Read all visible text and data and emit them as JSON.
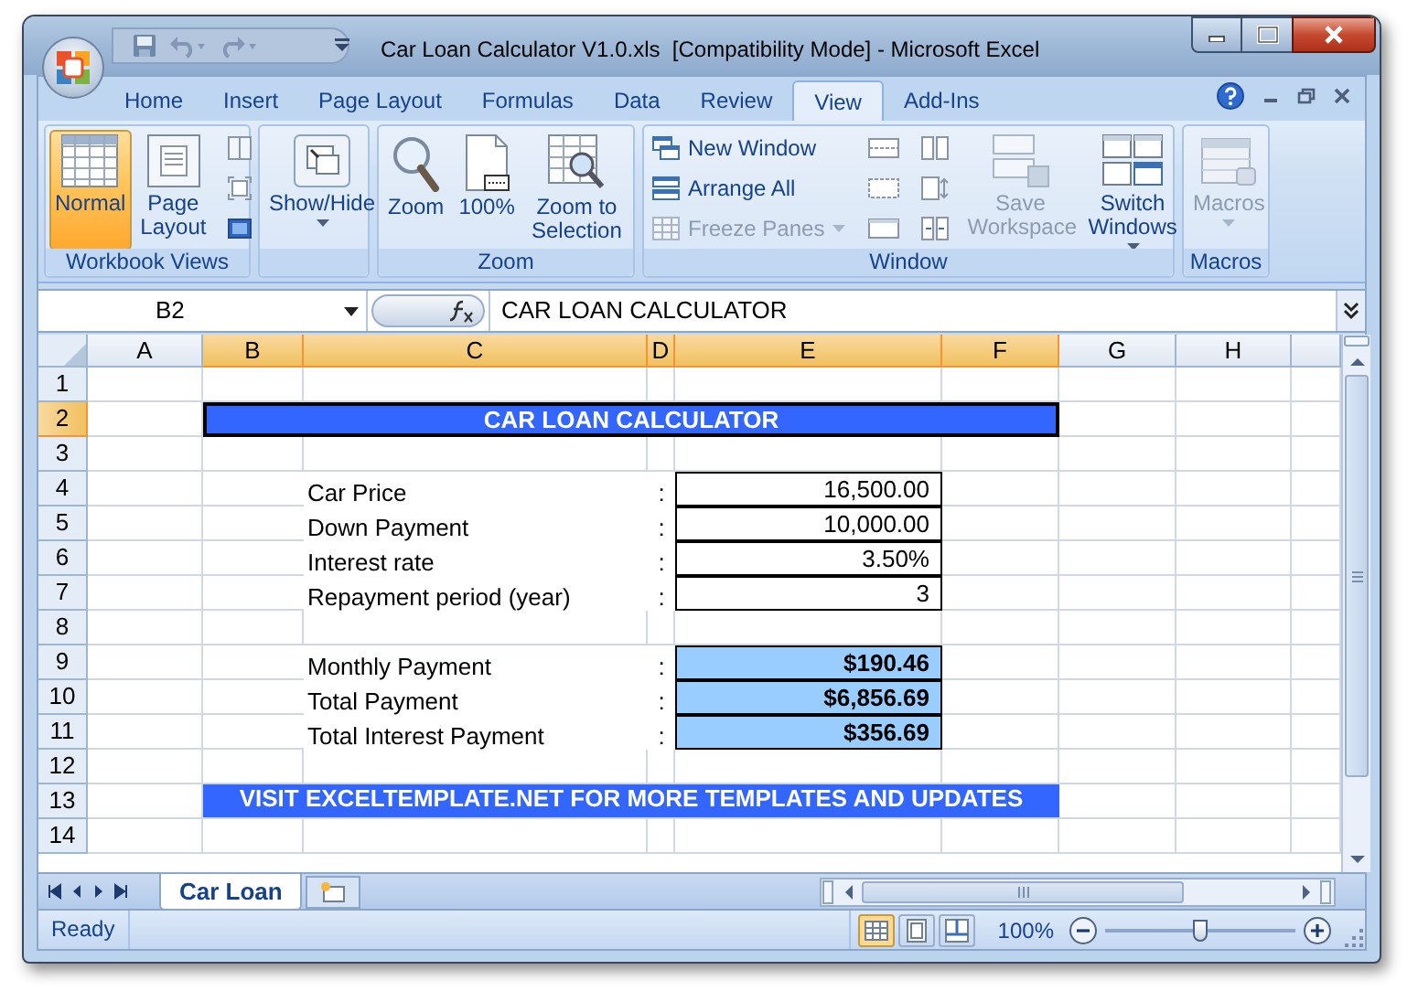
{
  "window": {
    "title": "Car Loan Calculator V1.0.xls  [Compatibility Mode] - Microsoft Excel"
  },
  "tabs": [
    {
      "label": "Home",
      "selected": false
    },
    {
      "label": "Insert",
      "selected": false
    },
    {
      "label": "Page Layout",
      "selected": false
    },
    {
      "label": "Formulas",
      "selected": false
    },
    {
      "label": "Data",
      "selected": false
    },
    {
      "label": "Review",
      "selected": false
    },
    {
      "label": "View",
      "selected": true
    },
    {
      "label": "Add-Ins",
      "selected": false
    }
  ],
  "ribbon": {
    "groups": [
      {
        "label": "Workbook Views",
        "items": [
          {
            "kind": "large",
            "label": "Normal",
            "selected": true,
            "disabled": false,
            "dropdown": false
          },
          {
            "kind": "large",
            "label": "Page Layout",
            "selected": false,
            "disabled": false,
            "dropdown": false
          },
          {
            "kind": "icon",
            "selected": false,
            "disabled": false,
            "dropdown": false
          },
          {
            "kind": "icon",
            "selected": false,
            "disabled": false,
            "dropdown": false
          },
          {
            "kind": "icon",
            "selected": false,
            "disabled": false,
            "dropdown": false
          }
        ]
      },
      {
        "items": [
          {
            "kind": "large",
            "label": "Show/Hide",
            "disabled": false,
            "dropdown": true
          }
        ]
      },
      {
        "label": "Zoom",
        "items": [
          {
            "kind": "large",
            "label": "Zoom",
            "disabled": false,
            "dropdown": false
          },
          {
            "kind": "large",
            "label": "100%",
            "disabled": false,
            "dropdown": false
          },
          {
            "kind": "large",
            "label": "Zoom to Selection",
            "disabled": false,
            "dropdown": false
          }
        ]
      },
      {
        "label": "Window",
        "items": [
          {
            "kind": "small",
            "label": "New Window",
            "disabled": false,
            "dropdown": false
          },
          {
            "kind": "small",
            "label": "Arrange All",
            "disabled": false,
            "dropdown": false
          },
          {
            "kind": "small",
            "label": "Freeze Panes",
            "disabled": true,
            "dropdown": true
          },
          {
            "kind": "icon",
            "disabled": false,
            "dropdown": false
          },
          {
            "kind": "icon",
            "disabled": false,
            "dropdown": false
          },
          {
            "kind": "icon",
            "disabled": false,
            "dropdown": false
          },
          {
            "kind": "icon",
            "disabled": false,
            "dropdown": false
          },
          {
            "kind": "icon",
            "disabled": false,
            "dropdown": false
          },
          {
            "kind": "icon",
            "disabled": false,
            "dropdown": false
          },
          {
            "kind": "large",
            "label": "Save Workspace",
            "disabled": true,
            "dropdown": false
          },
          {
            "kind": "large",
            "label": "Switch Windows",
            "disabled": false,
            "dropdown": true
          }
        ]
      },
      {
        "label": "Macros",
        "items": [
          {
            "kind": "large",
            "label": "Macros",
            "disabled": true,
            "dropdown": true
          }
        ]
      }
    ]
  },
  "formula_bar": {
    "name_box": "B2",
    "formula": "CAR LOAN CALCULATOR"
  },
  "sheet": {
    "columns": [
      {
        "label": "A",
        "selected": false
      },
      {
        "label": "B",
        "selected": true
      },
      {
        "label": "C",
        "selected": true
      },
      {
        "label": "D",
        "selected": true
      },
      {
        "label": "E",
        "selected": true
      },
      {
        "label": "F",
        "selected": true
      },
      {
        "label": "G",
        "selected": false
      },
      {
        "label": "H",
        "selected": false
      }
    ],
    "rows": [
      {
        "number": "1",
        "selected": false,
        "kind": "blank"
      },
      {
        "number": "2",
        "selected": true,
        "kind": "banner",
        "text": "CAR LOAN CALCULATOR",
        "active": true
      },
      {
        "number": "3",
        "selected": false,
        "kind": "blank"
      },
      {
        "number": "4",
        "selected": false,
        "kind": "input",
        "label": "Car Price",
        "separator": ":",
        "value": "16,500.00"
      },
      {
        "number": "5",
        "selected": false,
        "kind": "input",
        "label": "Down Payment",
        "separator": ":",
        "value": "10,000.00"
      },
      {
        "number": "6",
        "selected": false,
        "kind": "input",
        "label": "Interest rate",
        "separator": ":",
        "value": "3.50%"
      },
      {
        "number": "7",
        "selected": false,
        "kind": "input",
        "label": "Repayment period (year)",
        "separator": ":",
        "value": "3"
      },
      {
        "number": "8",
        "selected": false,
        "kind": "blank"
      },
      {
        "number": "9",
        "selected": false,
        "kind": "result",
        "label": "Monthly Payment",
        "separator": ":",
        "value": "$190.46"
      },
      {
        "number": "10",
        "selected": false,
        "kind": "result",
        "label": "Total Payment",
        "separator": ":",
        "value": "$6,856.69"
      },
      {
        "number": "11",
        "selected": false,
        "kind": "result",
        "label": "Total Interest Payment",
        "separator": ":",
        "value": "$356.69"
      },
      {
        "number": "12",
        "selected": false,
        "kind": "blank"
      },
      {
        "number": "13",
        "selected": false,
        "kind": "banner",
        "text": "VISIT EXCELTEMPLATE.NET FOR MORE TEMPLATES AND UPDATES",
        "active": false
      },
      {
        "number": "14",
        "selected": false,
        "kind": "blank"
      }
    ]
  },
  "sheet_tabs": [
    {
      "label": "Car Loan",
      "selected": true
    }
  ],
  "status_bar": {
    "status": "Ready",
    "views": [
      {
        "selected": true
      },
      {
        "selected": false
      },
      {
        "selected": false
      }
    ],
    "zoom": "100%",
    "zoom_slider": {
      "level": 0.5
    }
  }
}
